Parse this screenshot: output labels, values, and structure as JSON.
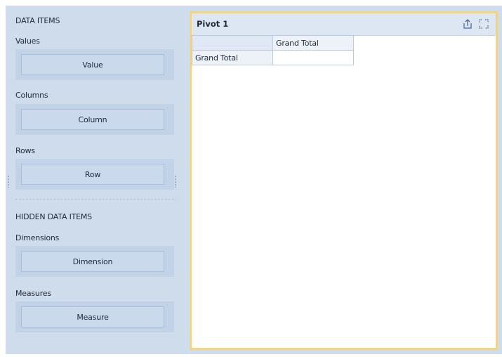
{
  "data_items": {
    "section_title": "DATA ITEMS",
    "values": {
      "label": "Values",
      "placeholder": "Value"
    },
    "columns": {
      "label": "Columns",
      "placeholder": "Column"
    },
    "rows": {
      "label": "Rows",
      "placeholder": "Row"
    }
  },
  "hidden_data_items": {
    "section_title": "HIDDEN DATA ITEMS",
    "dimensions": {
      "label": "Dimensions",
      "placeholder": "Dimension"
    },
    "measures": {
      "label": "Measures",
      "placeholder": "Measure"
    }
  },
  "pivot": {
    "title": "Pivot 1",
    "column_header": "Grand Total",
    "row_header": "Grand Total",
    "cell_value": "",
    "icons": [
      "export-icon",
      "maximize-icon"
    ]
  },
  "colors": {
    "panel_bg": "#cfdcec",
    "selection_border": "#f5d57a",
    "header_bg": "#dde7f3"
  }
}
